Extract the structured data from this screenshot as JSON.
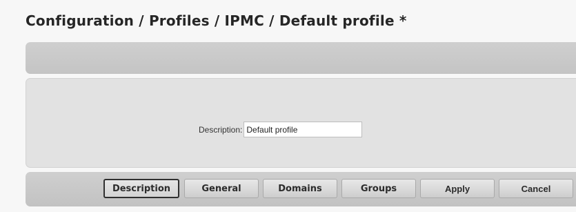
{
  "header": {
    "title": "Configuration / Profiles / IPMC / Default profile *"
  },
  "form": {
    "description_label": "Description:",
    "description_value": "Default profile"
  },
  "tabs": [
    {
      "label": "Description",
      "active": true
    },
    {
      "label": "General",
      "active": false
    },
    {
      "label": "Domains",
      "active": false
    },
    {
      "label": "Groups",
      "active": false
    }
  ],
  "actions": {
    "apply_label": "Apply",
    "cancel_label": "Cancel"
  }
}
